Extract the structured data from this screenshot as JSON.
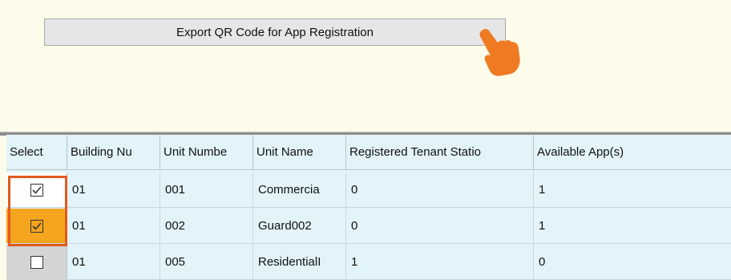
{
  "export_button": {
    "label": "Export QR Code for App Registration"
  },
  "icons": {
    "pointer": "hand-pointer-icon",
    "checkbox": "checkbox-icon"
  },
  "colors": {
    "panel_bg": "#fdfcea",
    "grid_bg": "#e2f4fa",
    "selected_row_bg": "#f5a41e",
    "highlight_border": "#e25a1c",
    "pointer": "#ef7a22"
  },
  "table": {
    "headers": [
      "Select",
      "Building Nu",
      "Unit Numbe",
      "Unit Name",
      "Registered Tenant Statio",
      "Available App(s)"
    ],
    "rows": [
      {
        "checked": true,
        "cells": [
          "01",
          "001",
          "Commercia",
          "0",
          "1"
        ]
      },
      {
        "checked": true,
        "cells": [
          "01",
          "002",
          "Guard002",
          "0",
          "1"
        ]
      },
      {
        "checked": false,
        "cells": [
          "01",
          "005",
          "ResidentialI",
          "1",
          "0"
        ]
      }
    ]
  }
}
